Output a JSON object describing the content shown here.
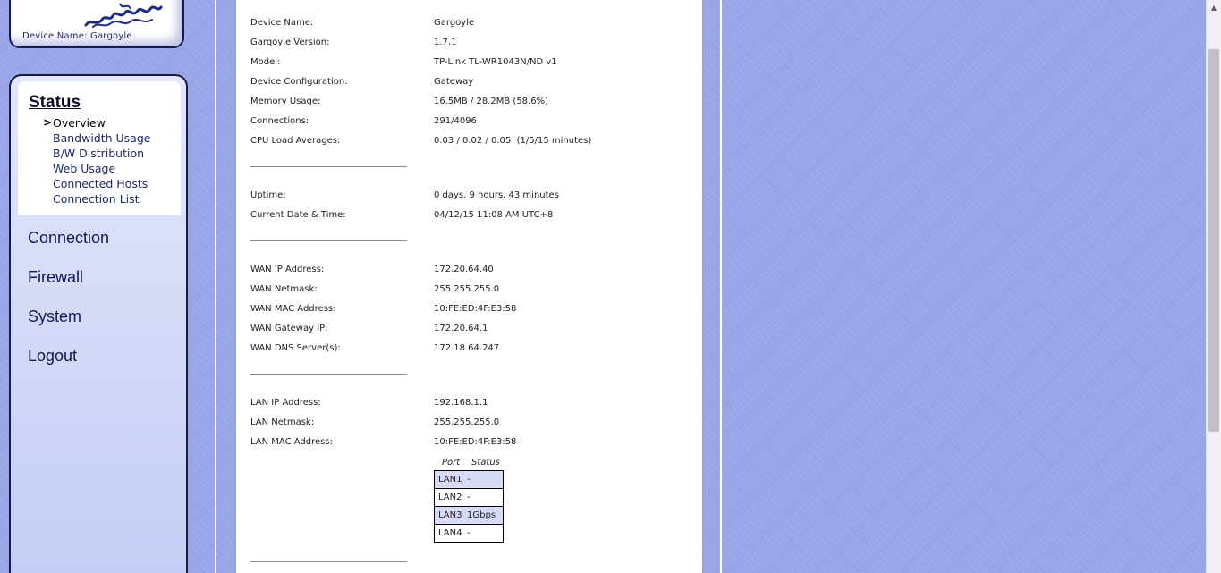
{
  "header": {
    "device_caption": "Device Name: Gargoyle"
  },
  "nav": {
    "section_title": "Status",
    "sub_items": [
      {
        "label": "Overview",
        "active": true
      },
      {
        "label": "Bandwidth Usage"
      },
      {
        "label": "B/W Distribution"
      },
      {
        "label": "Web Usage"
      },
      {
        "label": "Connected Hosts"
      },
      {
        "label": "Connection List"
      }
    ],
    "main_items": [
      {
        "label": "Connection"
      },
      {
        "label": "Firewall"
      },
      {
        "label": "System"
      },
      {
        "label": "Logout"
      }
    ],
    "active_arrow": ">"
  },
  "overview": {
    "device_name": {
      "label": "Device Name:",
      "value": "Gargoyle"
    },
    "version": {
      "label": "Gargoyle Version:",
      "value": "1.7.1"
    },
    "model": {
      "label": "Model:",
      "value": "TP-Link TL-WR1043N/ND v1"
    },
    "config": {
      "label": "Device Configuration:",
      "value": "Gateway"
    },
    "memory": {
      "label": "Memory Usage:",
      "value": "16.5MB / 28.2MB (58.6%)"
    },
    "connections": {
      "label": "Connections:",
      "value": "291/4096"
    },
    "cpu": {
      "label": "CPU Load Averages:",
      "value": "0.03 / 0.02 / 0.05  (1/5/15 minutes)"
    },
    "uptime": {
      "label": "Uptime:",
      "value": "0 days, 9 hours, 43 minutes"
    },
    "datetime": {
      "label": "Current Date & Time:",
      "value": "04/12/15 11:08 AM UTC+8"
    },
    "wan_ip": {
      "label": "WAN IP Address:",
      "value": "172.20.64.40"
    },
    "wan_mask": {
      "label": "WAN Netmask:",
      "value": "255.255.255.0"
    },
    "wan_mac": {
      "label": "WAN MAC Address:",
      "value": "10:FE:ED:4F:E3:58"
    },
    "wan_gw": {
      "label": "WAN Gateway IP:",
      "value": "172.20.64.1"
    },
    "wan_dns": {
      "label": "WAN DNS Server(s):",
      "value": "172.18.64.247"
    },
    "lan_ip": {
      "label": "LAN IP Address:",
      "value": "192.168.1.1"
    },
    "lan_mask": {
      "label": "LAN Netmask:",
      "value": "255.255.255.0"
    },
    "lan_mac": {
      "label": "LAN MAC Address:",
      "value": "10:FE:ED:4F:E3:58"
    }
  },
  "ports": {
    "header_port": "Port",
    "header_status": "Status",
    "rows": [
      {
        "port": "LAN1",
        "status": "-"
      },
      {
        "port": "LAN2",
        "status": "-"
      },
      {
        "port": "LAN3",
        "status": "1Gbps"
      },
      {
        "port": "LAN4",
        "status": "-"
      }
    ]
  },
  "colors": {
    "background": "#98a6e8",
    "nav_text": "#101a55",
    "port_shade": "#d8dbf8"
  }
}
